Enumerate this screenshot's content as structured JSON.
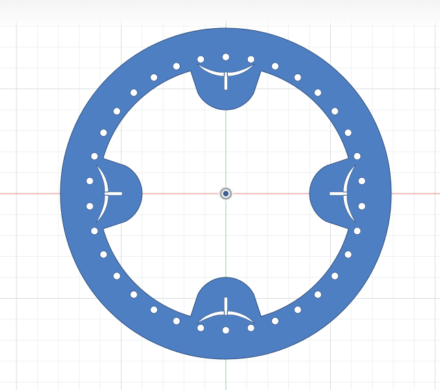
{
  "scene": {
    "view": "top",
    "grid_visible": true,
    "x_axis_visible": true,
    "y_axis_visible": true,
    "origin_marker_visible": true
  },
  "part": {
    "shape": "flat ring with 4 lobed mounting tabs",
    "hole_count": 34,
    "hole_groups": [
      {
        "position": "top",
        "holes_per_side": 1
      },
      {
        "position": "right",
        "holes_per_side": 1
      },
      {
        "position": "bottom",
        "holes_per_side": 1
      },
      {
        "position": "left",
        "holes_per_side": 1
      }
    ],
    "tab_count": 4
  },
  "colors": {
    "background": "#ffffff",
    "grid_minor": "#eef0f2",
    "grid_major": "#d9dde1",
    "x_axis": "#e8807a",
    "y_axis": "#8fd39a",
    "part_fill": "#4f7fc3",
    "part_edge": "#2f4f7a",
    "hole_fill": "#ffffff",
    "origin_outer": "#9aa0a6",
    "origin_inner": "#3f5f8f"
  }
}
